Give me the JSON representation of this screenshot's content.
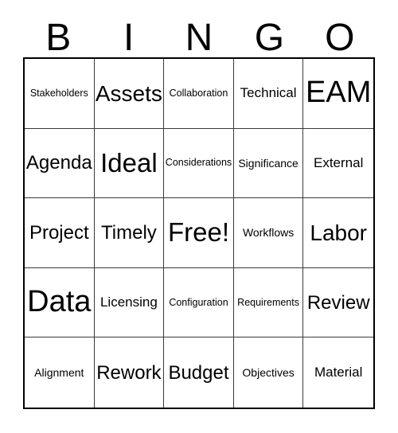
{
  "card": {
    "title": "BINGO",
    "header_letters": [
      "B",
      "I",
      "N",
      "G",
      "O"
    ],
    "colors": {
      "background": "#ffffff",
      "text": "#000000",
      "outer_border": "#000000",
      "inner_grid_line": "#3a3a3a"
    },
    "grid": {
      "columns": 5,
      "rows": 5,
      "free_space": "Free!",
      "free_space_position": {
        "row": 3,
        "column": 3
      }
    },
    "cells": [
      {
        "text": "Stakeholders",
        "size": "fs-xs"
      },
      {
        "text": "Assets",
        "size": "fs-xxl"
      },
      {
        "text": "Collaboration",
        "size": "fs-xs"
      },
      {
        "text": "Technical",
        "size": "fs-md"
      },
      {
        "text": "EAM",
        "size": "fs-max"
      },
      {
        "text": "Agenda",
        "size": "fs-xl"
      },
      {
        "text": "Ideal",
        "size": "fs-huge"
      },
      {
        "text": "Considerations",
        "size": "fs-xs"
      },
      {
        "text": "Significance",
        "size": "fs-sm"
      },
      {
        "text": "External",
        "size": "fs-md"
      },
      {
        "text": "Project",
        "size": "fs-xl"
      },
      {
        "text": "Timely",
        "size": "fs-xl"
      },
      {
        "text": "Free!",
        "size": "fs-huge"
      },
      {
        "text": "Workflows",
        "size": "fs-sm"
      },
      {
        "text": "Labor",
        "size": "fs-xxl"
      },
      {
        "text": "Data",
        "size": "fs-max"
      },
      {
        "text": "Licensing",
        "size": "fs-md"
      },
      {
        "text": "Configuration",
        "size": "fs-xs"
      },
      {
        "text": "Requirements",
        "size": "fs-xs"
      },
      {
        "text": "Review",
        "size": "fs-xl"
      },
      {
        "text": "Alignment",
        "size": "fs-sm"
      },
      {
        "text": "Rework",
        "size": "fs-xl"
      },
      {
        "text": "Budget",
        "size": "fs-xl"
      },
      {
        "text": "Objectives",
        "size": "fs-sm"
      },
      {
        "text": "Material",
        "size": "fs-md"
      }
    ]
  }
}
